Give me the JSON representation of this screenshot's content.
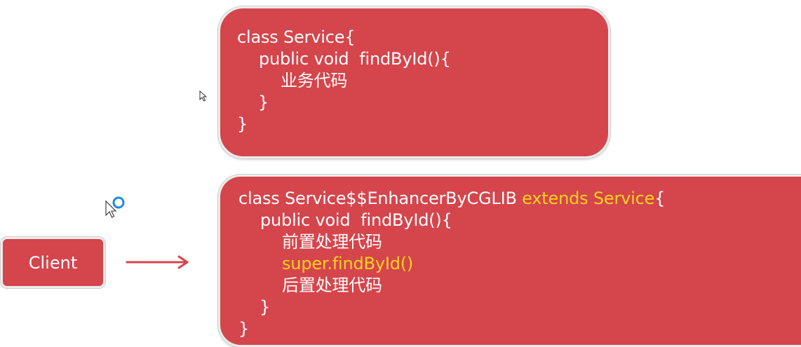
{
  "top_box": {
    "line1": "class Service{",
    "line2": "public void  findById(){",
    "line3": "业务代码",
    "line4": "}",
    "line5": "}"
  },
  "bottom_box": {
    "line1_a": "class Service$$EnhancerByCGLIB ",
    "line1_b": "extends Service",
    "line1_c": "{",
    "line2": "public void  findById(){",
    "line3": "前置处理代码",
    "line4": "super.findById()",
    "line5": "后置处理代码",
    "line6": "}",
    "line7": "}"
  },
  "client": {
    "label": "Client"
  },
  "colors": {
    "box_fill": "#d5454c",
    "highlight": "#ffd21f",
    "arrow": "#d5454c"
  }
}
